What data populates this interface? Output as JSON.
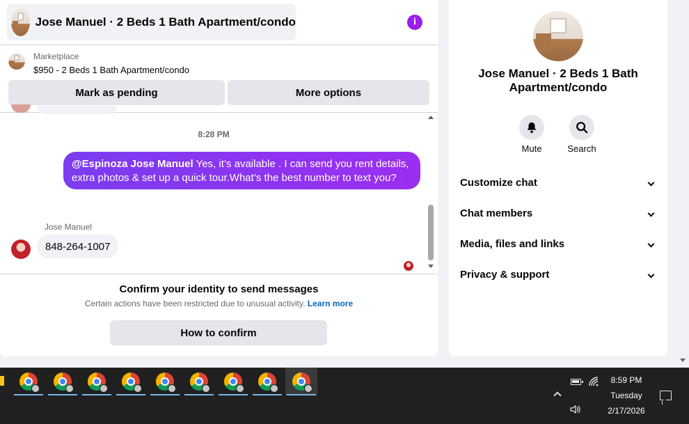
{
  "chat": {
    "title": "Jose Manuel · 2 Beds 1 Bath Apartment/condo",
    "info_icon": "info-icon",
    "marketplace_label": "Marketplace",
    "listing": "$950 - 2 Beds 1 Bath Apartment/condo",
    "buttons": {
      "pending": "Mark as pending",
      "more": "More options"
    },
    "timestamp": "8:28 PM",
    "outgoing": {
      "mention": "@Espinoza Jose Manuel",
      "text": " Yes, it’s available .  I can send you rent details, extra photos & set up a quick tour.What’s the best number to text you?"
    },
    "incoming": {
      "sender": "Jose Manuel",
      "text": "848-264-1007"
    },
    "composer": {
      "title": "Confirm your identity to send messages",
      "desc": "Certain actions have been restricted due to unusual activity.",
      "learn_more": "Learn more",
      "confirm_button": "How to confirm"
    }
  },
  "side": {
    "title": "Jose Manuel · 2 Beds 1 Bath Apartment/condo",
    "actions": {
      "mute": "Mute",
      "search": "Search"
    },
    "sections": [
      "Customize chat",
      "Chat members",
      "Media, files and links",
      "Privacy & support"
    ]
  },
  "taskbar": {
    "time": "8:59 PM",
    "day": "Tuesday",
    "date": "2/17/2026",
    "app_icons": [
      "chrome-icon",
      "chrome-icon",
      "chrome-icon",
      "chrome-icon",
      "chrome-icon",
      "chrome-icon",
      "chrome-icon",
      "chrome-icon",
      "chrome-icon"
    ]
  },
  "colors": {
    "accent": "#9b1fe8",
    "link": "#0a66c2",
    "bubble_out_start": "#7b3cf0",
    "bubble_out_end": "#9b2ef0"
  }
}
